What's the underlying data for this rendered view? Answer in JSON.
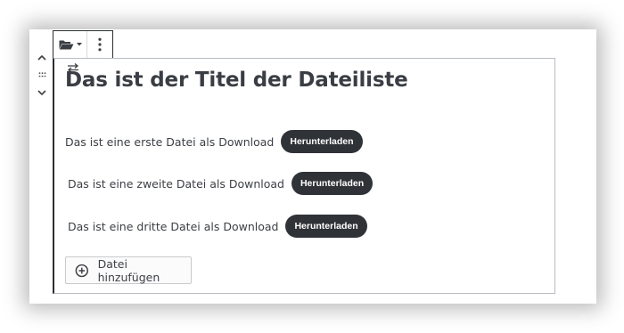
{
  "block": {
    "title": "Das ist der Titel der Dateiliste",
    "files": [
      {
        "label": "Das ist eine erste Datei als Download",
        "button": "Herunterladen"
      },
      {
        "label": "Das ist eine zweite Datei als Download",
        "button": "Herunterladen"
      },
      {
        "label": "Das ist eine dritte Datei als Download",
        "button": "Herunterladen"
      }
    ],
    "add_button": "Datei hinzufügen"
  },
  "icons": {
    "toolbar_block": "folder-open-icon",
    "toolbar_more": "more-vertical-icon",
    "mover_up": "chevron-up-icon",
    "mover_drag": "drag-handle-icon",
    "mover_down": "chevron-down-icon",
    "sort": "sort-arrows-icon",
    "add": "plus-circle-icon"
  },
  "colors": {
    "accent_dark": "#2f3237",
    "text": "#3c3f44",
    "border": "#b9bcc0"
  }
}
